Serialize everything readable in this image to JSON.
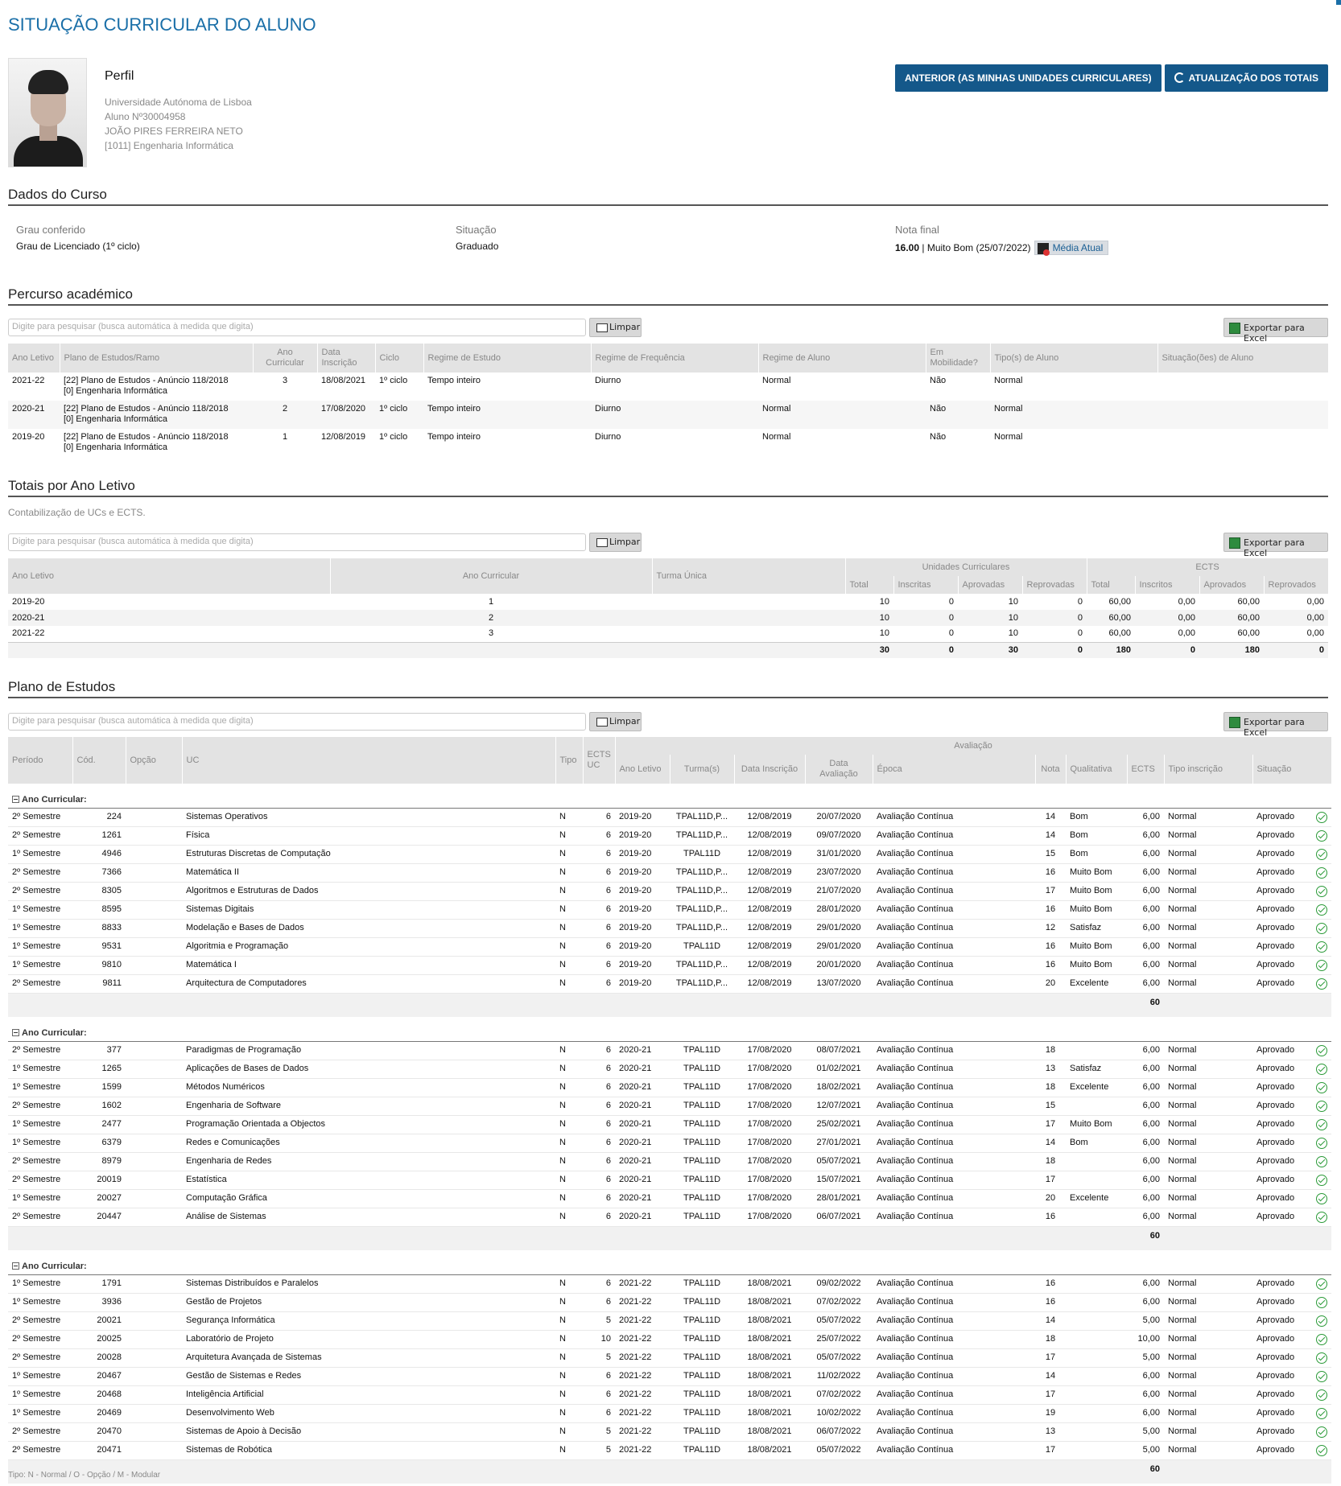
{
  "page_title": "SITUAÇÃO CURRICULAR DO ALUNO",
  "buttons": {
    "anterior": "ANTERIOR (AS MINHAS UNIDADES CURRICULARES)",
    "atualizacao": "ATUALIZAÇÃO DOS TOTAIS"
  },
  "profile": {
    "heading": "Perfil",
    "university": "Universidade Autónoma de Lisboa",
    "student_no": "Aluno Nº30004958",
    "name": "JOÃO PIRES FERREIRA NETO",
    "course": "[1011] Engenharia Informática"
  },
  "dados_curso": {
    "heading": "Dados do Curso",
    "grau_label": "Grau conferido",
    "grau_value": "Grau de Licenciado (1º ciclo)",
    "situacao_label": "Situação",
    "situacao_value": "Graduado",
    "nota_label": "Nota final",
    "nota_value": "16.00",
    "nota_rest": " | Muito Bom (25/07/2022)",
    "media_btn": "Média Atual"
  },
  "common": {
    "search_placeholder": "Digite para pesquisar (busca automática à medida que digita)",
    "limpar": "Limpar",
    "excel": "Exportar para Excel"
  },
  "percurso": {
    "heading": "Percurso académico",
    "headers": [
      "Ano Letivo",
      "Plano de Estudos/Ramo",
      "Ano Curricular",
      "Data Inscrição",
      "Ciclo",
      "Regime de Estudo",
      "Regime de Frequência",
      "Regime de Aluno",
      "Em Mobilidade?",
      "Tipo(s) de Aluno",
      "Situação(ões) de Aluno"
    ],
    "rows": [
      [
        "2021-22",
        "[22] Plano de Estudos - Anúncio 118/2018",
        "[0] Engenharia Informática",
        "3",
        "18/08/2021",
        "1º ciclo",
        "Tempo inteiro",
        "Diurno",
        "Normal",
        "Não",
        "Normal",
        ""
      ],
      [
        "2020-21",
        "[22] Plano de Estudos - Anúncio 118/2018",
        "[0] Engenharia Informática",
        "2",
        "17/08/2020",
        "1º ciclo",
        "Tempo inteiro",
        "Diurno",
        "Normal",
        "Não",
        "Normal",
        ""
      ],
      [
        "2019-20",
        "[22] Plano de Estudos - Anúncio 118/2018",
        "[0] Engenharia Informática",
        "1",
        "12/08/2019",
        "1º ciclo",
        "Tempo inteiro",
        "Diurno",
        "Normal",
        "Não",
        "Normal",
        ""
      ]
    ]
  },
  "totais": {
    "heading": "Totais por Ano Letivo",
    "description": "Contabilização de UCs e ECTS.",
    "headers": {
      "ano_letivo": "Ano Letivo",
      "ano_curricular": "Ano Curricular",
      "turma": "Turma Única",
      "ucs": "Unidades Curriculares",
      "ects": "ECTS",
      "sub": [
        "Total",
        "Inscritas",
        "Aprovadas",
        "Reprovadas",
        "Total",
        "Inscritos",
        "Aprovados",
        "Reprovados"
      ]
    },
    "rows": [
      [
        "2019-20",
        "1",
        "",
        "10",
        "0",
        "10",
        "0",
        "60,00",
        "0,00",
        "60,00",
        "0,00"
      ],
      [
        "2020-21",
        "2",
        "",
        "10",
        "0",
        "10",
        "0",
        "60,00",
        "0,00",
        "60,00",
        "0,00"
      ],
      [
        "2021-22",
        "3",
        "",
        "10",
        "0",
        "10",
        "0",
        "60,00",
        "0,00",
        "60,00",
        "0,00"
      ]
    ],
    "totals": [
      "30",
      "0",
      "30",
      "0",
      "180",
      "0",
      "180",
      "0"
    ]
  },
  "plano": {
    "heading": "Plano de Estudos",
    "headers": {
      "periodo": "Período",
      "cod": "Cód.",
      "opcao": "Opção",
      "uc": "UC",
      "tipo": "Tipo",
      "ects_uc": "ECTS UC",
      "avaliacao": "Avaliação",
      "sub": [
        "Ano Letivo",
        "Turma(s)",
        "Data Inscrição",
        "Data Avaliação",
        "Época",
        "Nota",
        "Qualitativa",
        "ECTS",
        "Tipo inscrição",
        "Situação"
      ]
    },
    "group_label": "Ano Curricular:",
    "groups": [
      {
        "subtotal": "60",
        "rows": [
          [
            "2º Semestre",
            "224",
            "Sistemas Operativos",
            "N",
            "6",
            "2019-20",
            "TPAL11D,P...",
            "12/08/2019",
            "20/07/2020",
            "Avaliação Contínua",
            "14",
            "Bom",
            "6,00",
            "Normal",
            "Aprovado"
          ],
          [
            "2º Semestre",
            "1261",
            "Física",
            "N",
            "6",
            "2019-20",
            "TPAL11D,P...",
            "12/08/2019",
            "09/07/2020",
            "Avaliação Contínua",
            "14",
            "Bom",
            "6,00",
            "Normal",
            "Aprovado"
          ],
          [
            "1º Semestre",
            "4946",
            "Estruturas Discretas de Computação",
            "N",
            "6",
            "2019-20",
            "TPAL11D",
            "12/08/2019",
            "31/01/2020",
            "Avaliação Contínua",
            "15",
            "Bom",
            "6,00",
            "Normal",
            "Aprovado"
          ],
          [
            "2º Semestre",
            "7366",
            "Matemática II",
            "N",
            "6",
            "2019-20",
            "TPAL11D,P...",
            "12/08/2019",
            "23/07/2020",
            "Avaliação Contínua",
            "16",
            "Muito Bom",
            "6,00",
            "Normal",
            "Aprovado"
          ],
          [
            "2º Semestre",
            "8305",
            "Algoritmos e Estruturas de Dados",
            "N",
            "6",
            "2019-20",
            "TPAL11D,P...",
            "12/08/2019",
            "21/07/2020",
            "Avaliação Contínua",
            "17",
            "Muito Bom",
            "6,00",
            "Normal",
            "Aprovado"
          ],
          [
            "1º Semestre",
            "8595",
            "Sistemas Digitais",
            "N",
            "6",
            "2019-20",
            "TPAL11D,P...",
            "12/08/2019",
            "28/01/2020",
            "Avaliação Contínua",
            "16",
            "Muito Bom",
            "6,00",
            "Normal",
            "Aprovado"
          ],
          [
            "1º Semestre",
            "8833",
            "Modelação e Bases de Dados",
            "N",
            "6",
            "2019-20",
            "TPAL11D,P...",
            "12/08/2019",
            "29/01/2020",
            "Avaliação Contínua",
            "12",
            "Satisfaz",
            "6,00",
            "Normal",
            "Aprovado"
          ],
          [
            "1º Semestre",
            "9531",
            "Algoritmia e Programação",
            "N",
            "6",
            "2019-20",
            "TPAL11D",
            "12/08/2019",
            "29/01/2020",
            "Avaliação Contínua",
            "16",
            "Muito Bom",
            "6,00",
            "Normal",
            "Aprovado"
          ],
          [
            "1º Semestre",
            "9810",
            "Matemática I",
            "N",
            "6",
            "2019-20",
            "TPAL11D,P...",
            "12/08/2019",
            "20/01/2020",
            "Avaliação Contínua",
            "16",
            "Muito Bom",
            "6,00",
            "Normal",
            "Aprovado"
          ],
          [
            "2º Semestre",
            "9811",
            "Arquitectura de Computadores",
            "N",
            "6",
            "2019-20",
            "TPAL11D,P...",
            "12/08/2019",
            "13/07/2020",
            "Avaliação Contínua",
            "20",
            "Excelente",
            "6,00",
            "Normal",
            "Aprovado"
          ]
        ]
      },
      {
        "subtotal": "60",
        "rows": [
          [
            "2º Semestre",
            "377",
            "Paradigmas de Programação",
            "N",
            "6",
            "2020-21",
            "TPAL11D",
            "17/08/2020",
            "08/07/2021",
            "Avaliação Contínua",
            "18",
            "",
            "6,00",
            "Normal",
            "Aprovado"
          ],
          [
            "1º Semestre",
            "1265",
            "Aplicações de Bases de Dados",
            "N",
            "6",
            "2020-21",
            "TPAL11D",
            "17/08/2020",
            "01/02/2021",
            "Avaliação Contínua",
            "13",
            "Satisfaz",
            "6,00",
            "Normal",
            "Aprovado"
          ],
          [
            "1º Semestre",
            "1599",
            "Métodos Numéricos",
            "N",
            "6",
            "2020-21",
            "TPAL11D",
            "17/08/2020",
            "18/02/2021",
            "Avaliação Contínua",
            "18",
            "Excelente",
            "6,00",
            "Normal",
            "Aprovado"
          ],
          [
            "2º Semestre",
            "1602",
            "Engenharia de Software",
            "N",
            "6",
            "2020-21",
            "TPAL11D",
            "17/08/2020",
            "12/07/2021",
            "Avaliação Contínua",
            "15",
            "",
            "6,00",
            "Normal",
            "Aprovado"
          ],
          [
            "1º Semestre",
            "2477",
            "Programação Orientada a Objectos",
            "N",
            "6",
            "2020-21",
            "TPAL11D",
            "17/08/2020",
            "25/02/2021",
            "Avaliação Contínua",
            "17",
            "Muito Bom",
            "6,00",
            "Normal",
            "Aprovado"
          ],
          [
            "1º Semestre",
            "6379",
            "Redes e Comunicações",
            "N",
            "6",
            "2020-21",
            "TPAL11D",
            "17/08/2020",
            "27/01/2021",
            "Avaliação Contínua",
            "14",
            "Bom",
            "6,00",
            "Normal",
            "Aprovado"
          ],
          [
            "2º Semestre",
            "8979",
            "Engenharia de Redes",
            "N",
            "6",
            "2020-21",
            "TPAL11D",
            "17/08/2020",
            "05/07/2021",
            "Avaliação Contínua",
            "18",
            "",
            "6,00",
            "Normal",
            "Aprovado"
          ],
          [
            "2º Semestre",
            "20019",
            "Estatística",
            "N",
            "6",
            "2020-21",
            "TPAL11D",
            "17/08/2020",
            "15/07/2021",
            "Avaliação Contínua",
            "17",
            "",
            "6,00",
            "Normal",
            "Aprovado"
          ],
          [
            "1º Semestre",
            "20027",
            "Computação Gráfica",
            "N",
            "6",
            "2020-21",
            "TPAL11D",
            "17/08/2020",
            "28/01/2021",
            "Avaliação Contínua",
            "20",
            "Excelente",
            "6,00",
            "Normal",
            "Aprovado"
          ],
          [
            "2º Semestre",
            "20447",
            "Análise de Sistemas",
            "N",
            "6",
            "2020-21",
            "TPAL11D",
            "17/08/2020",
            "06/07/2021",
            "Avaliação Contínua",
            "16",
            "",
            "6,00",
            "Normal",
            "Aprovado"
          ]
        ]
      },
      {
        "subtotal": "60",
        "rows": [
          [
            "1º Semestre",
            "1791",
            "Sistemas Distribuídos e Paralelos",
            "N",
            "6",
            "2021-22",
            "TPAL11D",
            "18/08/2021",
            "09/02/2022",
            "Avaliação Contínua",
            "16",
            "",
            "6,00",
            "Normal",
            "Aprovado"
          ],
          [
            "1º Semestre",
            "3936",
            "Gestão de Projetos",
            "N",
            "6",
            "2021-22",
            "TPAL11D",
            "18/08/2021",
            "07/02/2022",
            "Avaliação Contínua",
            "16",
            "",
            "6,00",
            "Normal",
            "Aprovado"
          ],
          [
            "2º Semestre",
            "20021",
            "Segurança Informática",
            "N",
            "5",
            "2021-22",
            "TPAL11D",
            "18/08/2021",
            "05/07/2022",
            "Avaliação Contínua",
            "14",
            "",
            "5,00",
            "Normal",
            "Aprovado"
          ],
          [
            "2º Semestre",
            "20025",
            "Laboratório de Projeto",
            "N",
            "10",
            "2021-22",
            "TPAL11D",
            "18/08/2021",
            "25/07/2022",
            "Avaliação Contínua",
            "18",
            "",
            "10,00",
            "Normal",
            "Aprovado"
          ],
          [
            "2º Semestre",
            "20028",
            "Arquitetura Avançada de Sistemas",
            "N",
            "5",
            "2021-22",
            "TPAL11D",
            "18/08/2021",
            "05/07/2022",
            "Avaliação Contínua",
            "17",
            "",
            "5,00",
            "Normal",
            "Aprovado"
          ],
          [
            "1º Semestre",
            "20467",
            "Gestão de Sistemas e Redes",
            "N",
            "6",
            "2021-22",
            "TPAL11D",
            "18/08/2021",
            "11/02/2022",
            "Avaliação Contínua",
            "14",
            "",
            "6,00",
            "Normal",
            "Aprovado"
          ],
          [
            "1º Semestre",
            "20468",
            "Inteligência Artificial",
            "N",
            "6",
            "2021-22",
            "TPAL11D",
            "18/08/2021",
            "07/02/2022",
            "Avaliação Contínua",
            "17",
            "",
            "6,00",
            "Normal",
            "Aprovado"
          ],
          [
            "1º Semestre",
            "20469",
            "Desenvolvimento Web",
            "N",
            "6",
            "2021-22",
            "TPAL11D",
            "18/08/2021",
            "10/02/2022",
            "Avaliação Contínua",
            "19",
            "",
            "6,00",
            "Normal",
            "Aprovado"
          ],
          [
            "2º Semestre",
            "20470",
            "Sistemas de Apoio à Decisão",
            "N",
            "5",
            "2021-22",
            "TPAL11D",
            "18/08/2021",
            "06/07/2022",
            "Avaliação Contínua",
            "13",
            "",
            "5,00",
            "Normal",
            "Aprovado"
          ],
          [
            "2º Semestre",
            "20471",
            "Sistemas de Robótica",
            "N",
            "5",
            "2021-22",
            "TPAL11D",
            "18/08/2021",
            "05/07/2022",
            "Avaliação Contínua",
            "17",
            "",
            "5,00",
            "Normal",
            "Aprovado"
          ]
        ]
      }
    ]
  },
  "footer": "Tipo: N - Normal / O - Opção / M - Modular",
  "colors": {
    "primary": "#14588a",
    "title": "#1a6fa8",
    "ok": "#2a9a37"
  }
}
